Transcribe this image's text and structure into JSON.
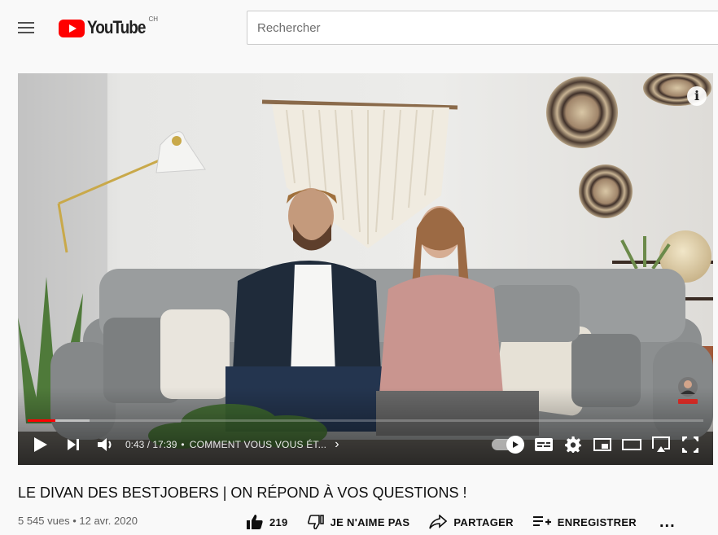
{
  "masthead": {
    "logo_text": "YouTube",
    "country_code": "CH",
    "search_placeholder": "Rechercher"
  },
  "player": {
    "time_current": "0:43",
    "time_total": "17:39",
    "time_display": "0:43 / 17:39",
    "chapter_separator": "•",
    "chapter_title": "COMMENT VOUS VOUS ÉT...",
    "progress_played_fraction": 0.0406,
    "progress_loaded_fraction": 0.092,
    "autoplay_on": true,
    "icons": [
      "play-icon",
      "next-icon",
      "volume-icon",
      "autoplay-toggle",
      "subtitles-icon",
      "settings-gear-icon",
      "miniplayer-icon",
      "theater-mode-icon",
      "cast-icon",
      "fullscreen-icon",
      "info-icon"
    ]
  },
  "video": {
    "title": "LE DIVAN DES BESTJOBERS | ON RÉPOND À VOS QUESTIONS !",
    "meta": "5 545 vues • 12 avr. 2020"
  },
  "actions": {
    "like_count": "219",
    "dislike_label": "JE N'AIME PAS",
    "share_label": "PARTAGER",
    "save_label": "ENREGISTRER",
    "more_label": "..."
  },
  "colors": {
    "brand_red": "#ff0000",
    "page_bg": "#f9f9f9",
    "text_primary": "#0f0f0f",
    "text_secondary": "#606060"
  }
}
